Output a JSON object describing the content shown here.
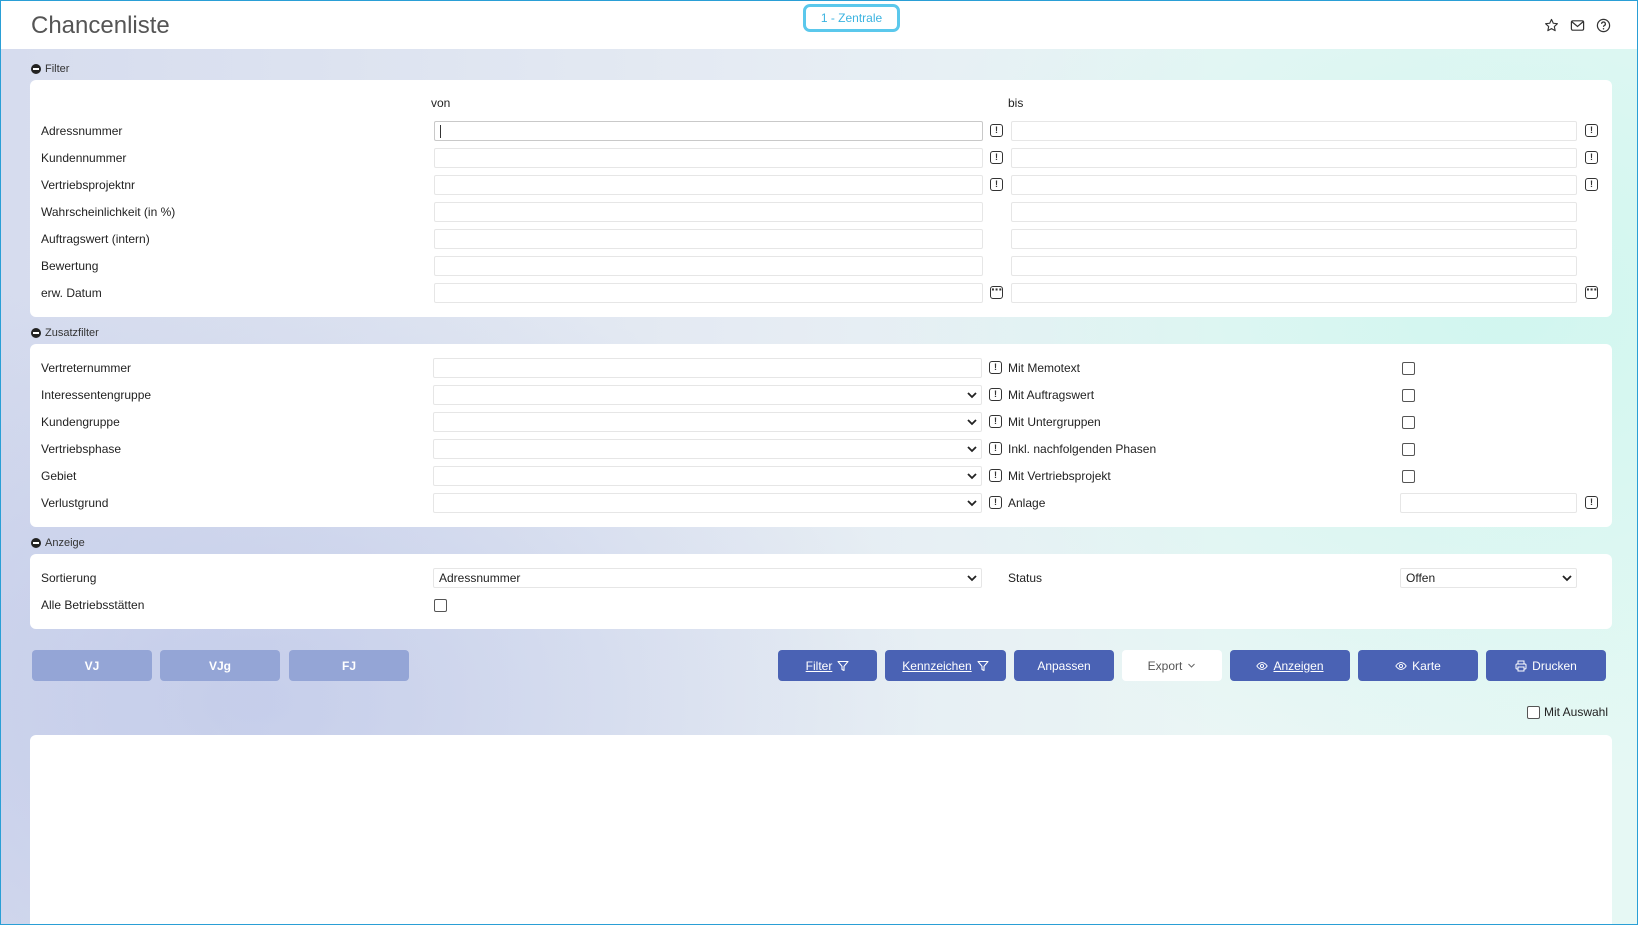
{
  "header": {
    "title": "Chancenliste",
    "branch": "1 - Zentrale",
    "icons": [
      "star-icon",
      "mail-icon",
      "help-icon"
    ]
  },
  "filter": {
    "section_label": "Filter",
    "col_from": "von",
    "col_to": "bis",
    "rows": [
      {
        "label": "Adressnummer",
        "icon": "lookup"
      },
      {
        "label": "Kundennummer",
        "icon": "lookup"
      },
      {
        "label": "Vertriebsprojektnr",
        "icon": "lookup"
      },
      {
        "label": "Wahrscheinlichkeit (in %)",
        "icon": ""
      },
      {
        "label": "Auftragswert (intern)",
        "icon": ""
      },
      {
        "label": "Bewertung",
        "icon": ""
      },
      {
        "label": "erw. Datum",
        "icon": "date"
      }
    ]
  },
  "zusatzfilter": {
    "section_label": "Zusatzfilter",
    "left": [
      {
        "label": "Vertreternummer"
      },
      {
        "label": "Interessentengruppe"
      },
      {
        "label": "Kundengruppe"
      },
      {
        "label": "Vertriebsphase"
      },
      {
        "label": "Gebiet"
      },
      {
        "label": "Verlustgrund"
      }
    ],
    "right": [
      {
        "label": "Mit Memotext"
      },
      {
        "label": "Mit Auftragswert"
      },
      {
        "label": "Mit Untergruppen"
      },
      {
        "label": "Inkl. nachfolgenden Phasen"
      },
      {
        "label": "Mit Vertriebsprojekt"
      },
      {
        "label": "Anlage"
      }
    ]
  },
  "anzeige": {
    "section_label": "Anzeige",
    "sort_label": "Sortierung",
    "sort_value": "Adressnummer",
    "status_label": "Status",
    "status_value": "Offen",
    "all_sites_label": "Alle Betriebsstätten"
  },
  "buttons": {
    "vj": "VJ",
    "vjg": "VJg",
    "fj": "FJ",
    "filter": "Filter",
    "kennzeichen": "Kennzeichen",
    "anpassen": "Anpassen",
    "export": "Export",
    "anzeigen": "Anzeigen",
    "karte": "Karte",
    "drucken": "Drucken"
  },
  "mit_auswahl": "Mit Auswahl",
  "colors": {
    "primary_button": "#4a62b4",
    "disabled_button": "#94a5d6",
    "branch_badge": "#5bc8ec",
    "window_border": "#2a9fd6"
  }
}
